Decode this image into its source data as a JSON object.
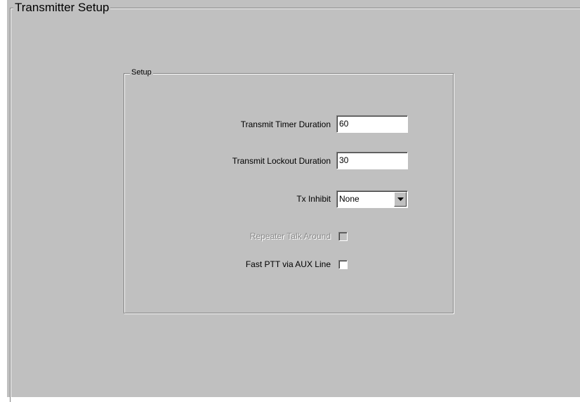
{
  "page": {
    "title": "Transmitter Setup"
  },
  "setup_group": {
    "title": "Setup",
    "transmit_timer": {
      "label": "Transmit Timer Duration",
      "value": "60"
    },
    "transmit_lockout": {
      "label": "Transmit Lockout Duration",
      "value": "30"
    },
    "tx_inhibit": {
      "label": "Tx Inhibit",
      "selected": "None"
    },
    "repeater_talk_around": {
      "label": "Repeater Talk Around",
      "checked": false,
      "enabled": false
    },
    "fast_ptt": {
      "label": "Fast PTT via AUX Line",
      "checked": false,
      "enabled": true
    }
  },
  "colors": {
    "panel_background": "#c0c0c0",
    "shadow": "#808080",
    "highlight": "#ffffff",
    "disabled_text": "#8a8a8a"
  }
}
